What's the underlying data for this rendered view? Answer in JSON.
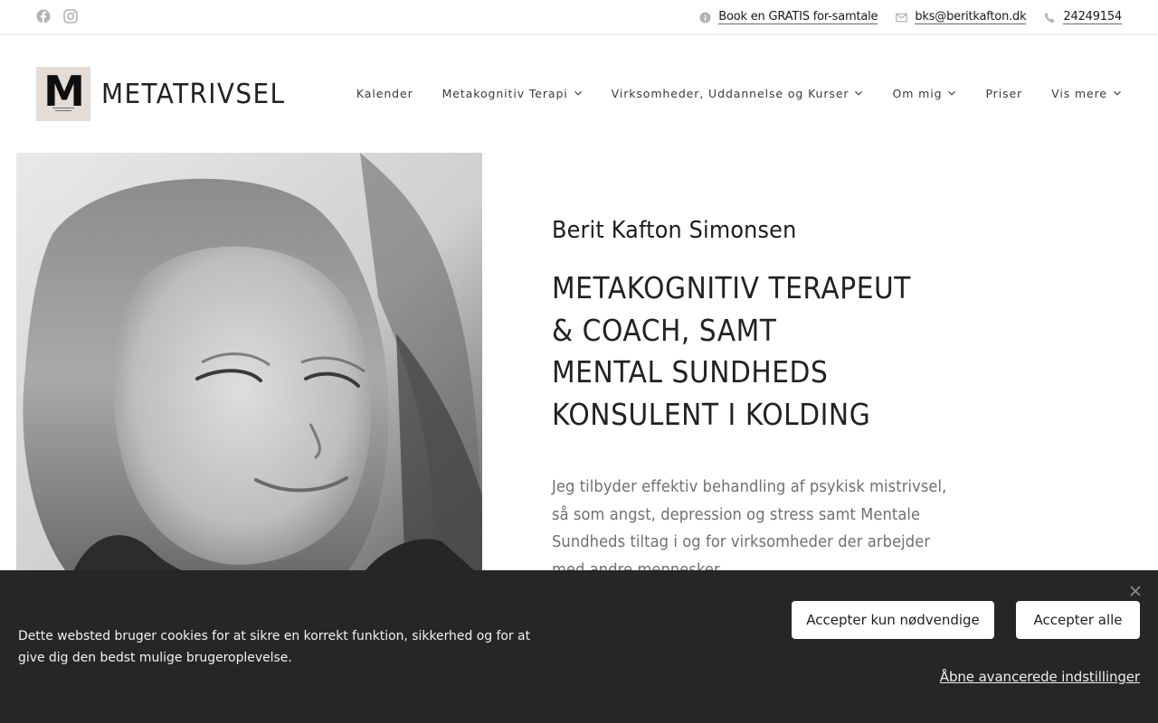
{
  "topbar": {
    "social": [
      {
        "icon": "facebook-icon"
      },
      {
        "icon": "instagram-icon"
      }
    ],
    "contacts": [
      {
        "icon": "info-icon",
        "label": "Book en GRATIS for-samtale"
      },
      {
        "icon": "mail-icon",
        "label": "bks@beritkafton.dk"
      },
      {
        "icon": "phone-icon",
        "label": "24249154"
      }
    ]
  },
  "header": {
    "logo_text": "METATRIVSEL",
    "logo_letter": "M",
    "nav": [
      {
        "label": "Kalender",
        "has_dropdown": false
      },
      {
        "label": "Metakognitiv Terapi",
        "has_dropdown": true
      },
      {
        "label": "Virksomheder, Uddannelse og Kurser",
        "has_dropdown": true
      },
      {
        "label": "Om mig",
        "has_dropdown": true
      },
      {
        "label": "Priser",
        "has_dropdown": false
      },
      {
        "label": "Vis mere",
        "has_dropdown": true
      }
    ]
  },
  "hero": {
    "name": "Berit Kafton Simonsen",
    "headline": "METAKOGNITIV TERAPEUT\n& COACH,  SAMT\nMENTAL SUNDHEDS\nKONSULENT I KOLDING",
    "intro": "Jeg tilbyder effektiv behandling af psykisk mistrivsel, så som angst, depression og stress samt Mentale Sundheds tiltag i og for virksomheder der arbejder med andre mennesker"
  },
  "cookie_banner": {
    "text": "Dette websted bruger cookies for at sikre en korrekt funktion, sikkerhed og for at give dig den bedst mulige brugeroplevelse.",
    "accept_necessary": "Accepter kun nødvendige",
    "accept_all": "Accepter alle",
    "advanced_settings": "Åbne avancerede indstillinger"
  },
  "colors": {
    "banner_bg": "#262626",
    "logo_bg": "#e4dcd5",
    "text_muted": "#707070"
  }
}
